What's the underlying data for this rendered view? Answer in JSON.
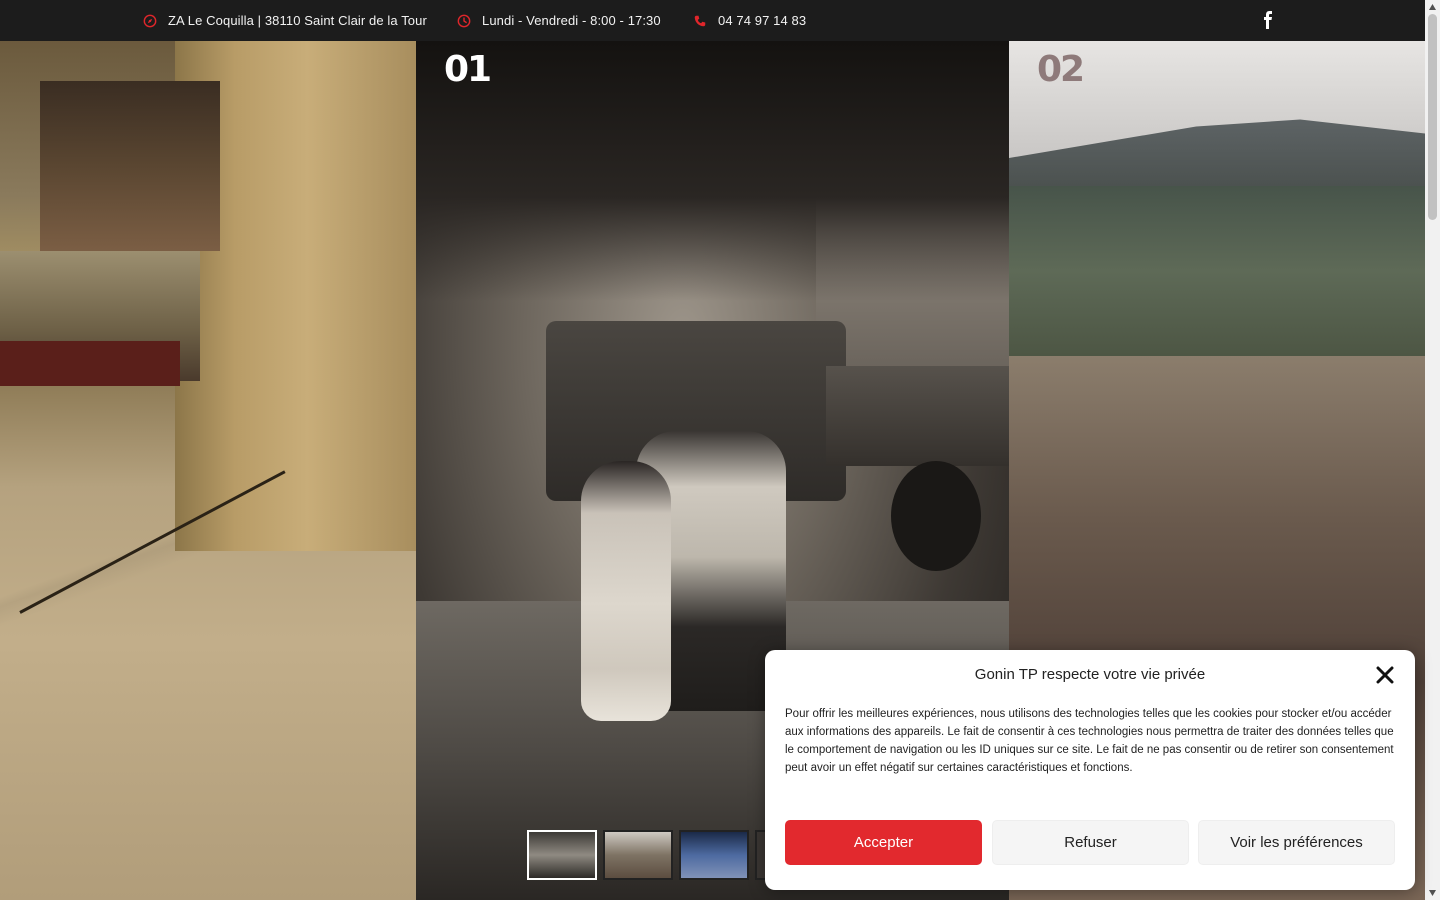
{
  "topbar": {
    "address": "ZA Le Coquilla | 38110 Saint Clair de la Tour",
    "hours": "Lundi - Vendredi - 8:00 - 17:30",
    "phone": "04 74 97 14 83",
    "address_icon": "compass-icon",
    "hours_icon": "clock-icon",
    "phone_icon": "phone-icon",
    "social_icon": "facebook-icon",
    "accent_color": "#e0262b"
  },
  "slides": [
    {
      "number": "01"
    },
    {
      "number": "02"
    }
  ],
  "gallery": {
    "thumbnails": [
      "thumbnail-1",
      "thumbnail-2",
      "thumbnail-3",
      "thumbnail-4"
    ],
    "active_index": 0
  },
  "cookie_banner": {
    "title": "Gonin TP respecte votre vie privée",
    "body": "Pour offrir les meilleures expériences, nous utilisons des technologies telles que les cookies pour stocker et/ou accéder aux informations des appareils. Le fait de consentir à ces technologies nous permettra de traiter des données telles que le comportement de navigation ou les ID uniques sur ce site. Le fait de ne pas consentir ou de retirer son consentement peut avoir un effet négatif sur certaines caractéristiques et fonctions.",
    "accept_label": "Accepter",
    "refuse_label": "Refuser",
    "preferences_label": "Voir les préférences",
    "accept_color": "#e2292e"
  }
}
